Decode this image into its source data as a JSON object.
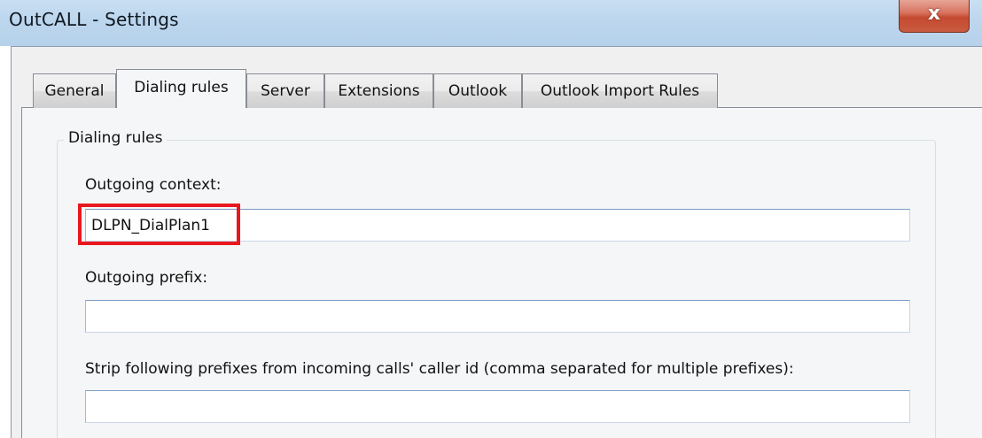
{
  "window": {
    "title": "OutCALL - Settings",
    "close_glyph": "x"
  },
  "tabs": [
    {
      "label": "General",
      "active": false
    },
    {
      "label": "Dialing rules",
      "active": true
    },
    {
      "label": "Server",
      "active": false
    },
    {
      "label": "Extensions",
      "active": false
    },
    {
      "label": "Outlook",
      "active": false
    },
    {
      "label": "Outlook Import Rules",
      "active": false
    }
  ],
  "dialing_rules": {
    "group_title": "Dialing rules",
    "outgoing_context": {
      "label": "Outgoing context:",
      "value": "DLPN_DialPlan1"
    },
    "outgoing_prefix": {
      "label": "Outgoing prefix:",
      "value": ""
    },
    "strip_prefixes": {
      "label": "Strip following prefixes from incoming calls' caller id (comma separated for multiple prefixes):",
      "value": ""
    }
  },
  "colors": {
    "highlight": "#e8181e",
    "titlebar": "#bcd6ee",
    "close_button": "#c44a30"
  }
}
